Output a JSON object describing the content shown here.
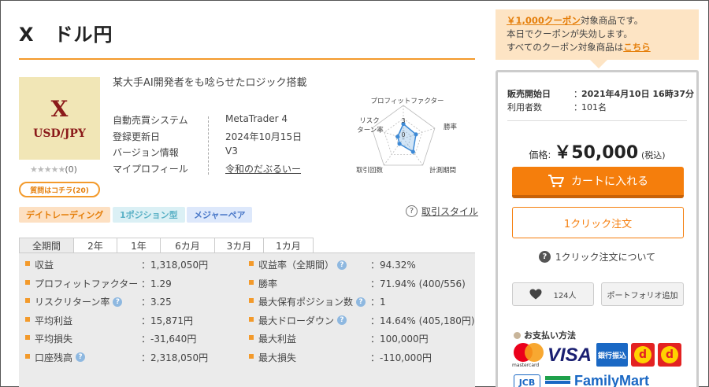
{
  "product": {
    "title": "X　ドル円",
    "image_line1": "X",
    "image_line2": "USD/JPY",
    "stars": "★★★★★",
    "rating_count": "(0)",
    "question_label": "質問はコチラ(20)",
    "headline": "某大手AI開発者をも唸らせたロジック搭載",
    "info": [
      {
        "key": "自動売買システム",
        "value": "MetaTrader 4"
      },
      {
        "key": "登録更新日",
        "value": "2024年10月15日"
      },
      {
        "key": "バージョン情報",
        "value": "V3"
      },
      {
        "key": "マイプロフィール",
        "value": "令和のだぶるいー"
      }
    ],
    "tags": [
      "デイトレーディング",
      "1ポジション型",
      "メジャーペア"
    ],
    "trading_style_label": "取引スタイル"
  },
  "radar": {
    "labels": [
      "プロフィットファクター",
      "勝率",
      "計測期間",
      "取引回数",
      "リスクターン率"
    ],
    "label_lines": {
      "risk_line1": "リスク",
      "risk_line2": "ターン率"
    },
    "scale_labels": [
      "3",
      "0"
    ],
    "values": [
      2.2,
      2.0,
      2.5,
      1.0,
      0.9
    ],
    "max": 5,
    "colors": {
      "fill": "#7fb4e6",
      "stroke": "#3d8ad6",
      "grid": "#bbbbbb"
    }
  },
  "tabs": [
    "全期間",
    "2年",
    "1年",
    "6カ月",
    "3カ月",
    "1カ月"
  ],
  "stats": {
    "left": [
      {
        "label": "収益",
        "value": "：1,318,050円",
        "help": false
      },
      {
        "label": "プロフィットファクター",
        "value": "：1.29",
        "help": false
      },
      {
        "label": "リスクリターン率",
        "value": "：3.25",
        "help": true
      },
      {
        "label": "平均利益",
        "value": "：15,871円",
        "help": false
      },
      {
        "label": "平均損失",
        "value": "：-31,640円",
        "help": false
      },
      {
        "label": "口座残高",
        "value": "：2,318,050円",
        "help": true
      }
    ],
    "right": [
      {
        "label": "収益率（全期間）",
        "value": "：94.32%",
        "help": true
      },
      {
        "label": "勝率",
        "value": "：71.94% (400/556)",
        "help": false
      },
      {
        "label": "最大保有ポジション数",
        "value": "：1",
        "help": true
      },
      {
        "label": "最大ドローダウン",
        "value": "：14.64% (405,180円)",
        "help": true
      },
      {
        "label": "最大利益",
        "value": "：100,000円",
        "help": false
      },
      {
        "label": "最大損失",
        "value": "：-110,000円",
        "help": false
      }
    ],
    "help_glyph": "?"
  },
  "coupon": {
    "highlight": "￥1,000クーポン",
    "line1_rest": "対象商品です。",
    "line2": "本日でクーポンが失効します。",
    "line3_prefix": "すべてのクーポン対象商品は",
    "line3_link": "こちら"
  },
  "sale": {
    "start_label": "販売開始日",
    "start_value": "2021年4月10日 16時37分",
    "users_label": "利用者数",
    "users_value": "101名",
    "colon": "："
  },
  "price": {
    "label": "価格:",
    "value": "￥50,000",
    "tax": "(税込)"
  },
  "buttons": {
    "cart": "カートに入れる",
    "oneclick": "1クリック注文",
    "oneclick_help": "1クリック注文について",
    "fav_count": "124人",
    "portfolio": "ポートフォリオ追加"
  },
  "payment": {
    "title": "お支払い方法",
    "mastercard": "mastercard",
    "visa": "VISA",
    "bank": "銀行振込",
    "jcb": "JCB",
    "familymart": "FamilyMart"
  },
  "colors": {
    "accent": "#f39a2b",
    "cart_button": "#f57e0c"
  }
}
